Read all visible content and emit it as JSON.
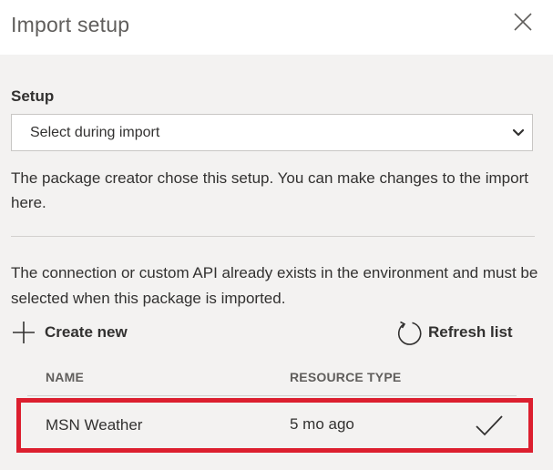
{
  "dialog": {
    "title": "Import setup",
    "close_icon": "close-icon"
  },
  "setup": {
    "label": "Setup",
    "selected_value": "Select during import",
    "chevron_icon": "chevron-down-icon",
    "description": "The package creator chose this setup. You can make changes to the import here."
  },
  "connection": {
    "description": "The connection or custom API already exists in the environment and must be selected when this package is imported.",
    "create_new_label": "Create new",
    "create_new_icon": "plus-icon",
    "refresh_label": "Refresh list",
    "refresh_icon": "refresh-icon"
  },
  "table": {
    "columns": [
      "NAME",
      "RESOURCE TYPE"
    ],
    "rows": [
      {
        "name": "MSN Weather",
        "resource_type": "5 mo ago",
        "selected": true,
        "check_icon": "checkmark-icon"
      }
    ]
  },
  "colors": {
    "header_bg": "#ffffff",
    "panel_bg": "#f3f2f1",
    "highlight_border": "#dc1f2f",
    "text": "#323130",
    "muted_text": "#605e5c"
  }
}
